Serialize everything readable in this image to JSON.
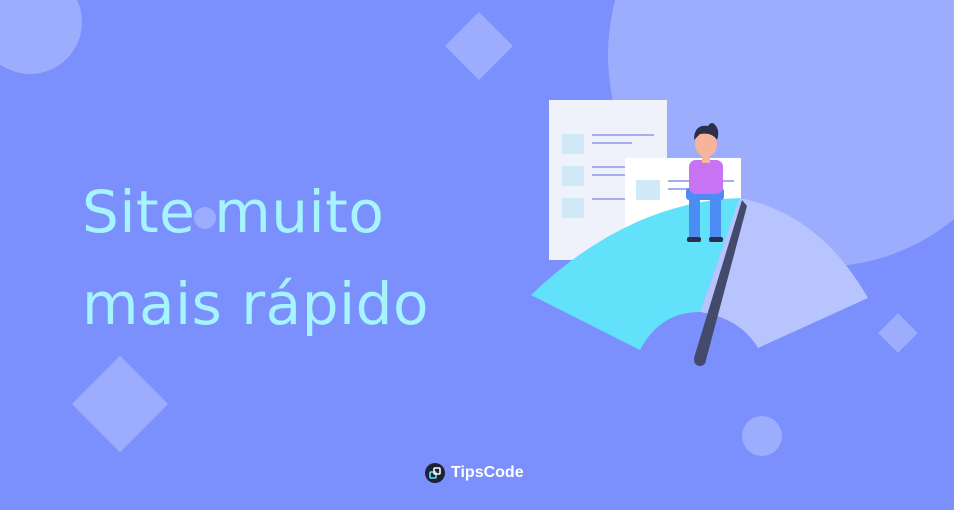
{
  "hero": {
    "headline_line1": "Site muito",
    "headline_line2": "mais rápido"
  },
  "brand": {
    "name": "TipsCode",
    "icon": "tipscode-logo-icon"
  },
  "illustration": {
    "icons": [
      "document-icon",
      "speedometer-gauge",
      "seated-person-figure"
    ]
  },
  "colors": {
    "background": "#7b8ffd",
    "shape_light": "#9dadfe",
    "headline": "#a6f4fd",
    "gauge_fast": "#62e1fb",
    "gauge_slow": "#b8c4fe",
    "needle": "#434a6b",
    "shirt": "#c873f3",
    "pants": "#4b8df4"
  }
}
